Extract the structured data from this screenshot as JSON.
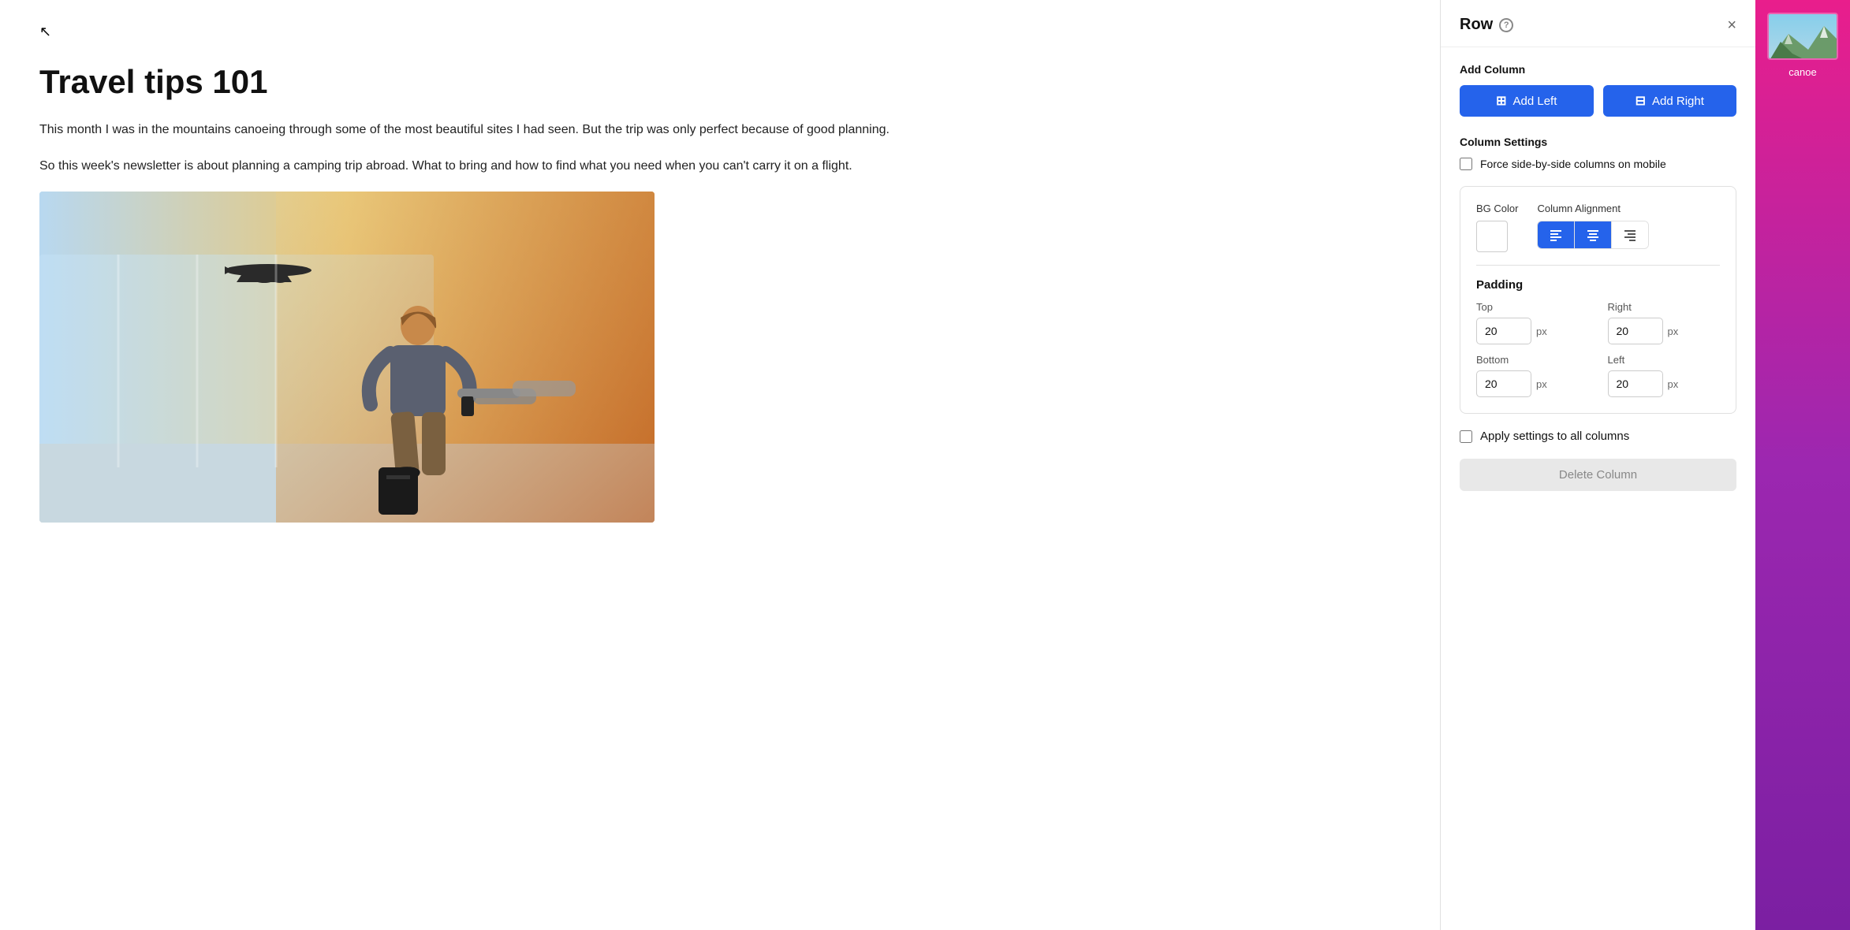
{
  "panel": {
    "title": "Row",
    "close_label": "×",
    "help_label": "?"
  },
  "add_column": {
    "section_title": "Add Column",
    "add_left_label": "Add Left",
    "add_right_label": "Add Right"
  },
  "column_settings": {
    "section_title": "Column Settings",
    "force_mobile_label": "Force side-by-side columns on mobile",
    "bg_color_label": "BG Color",
    "column_alignment_label": "Column Alignment",
    "alignment_options": [
      "left",
      "center",
      "right"
    ],
    "padding_title": "Padding",
    "top_label": "Top",
    "right_label": "Right",
    "bottom_label": "Bottom",
    "left_label": "Left",
    "top_value": "20",
    "right_value": "20",
    "bottom_value": "20",
    "left_value": "20",
    "px_label": "px",
    "apply_label": "Apply settings to all columns",
    "delete_label": "Delete Column"
  },
  "article": {
    "title": "Travel tips 101",
    "paragraph1": "This month I was in the mountains canoeing through some of the most beautiful sites I had seen. But the trip was only perfect because of good planning.",
    "paragraph2": "So this week's newsletter is about planning a camping trip abroad. What to bring and how to find what you need when you can't carry it on a flight."
  },
  "sidebar": {
    "thumbnail_label": "canoe"
  }
}
